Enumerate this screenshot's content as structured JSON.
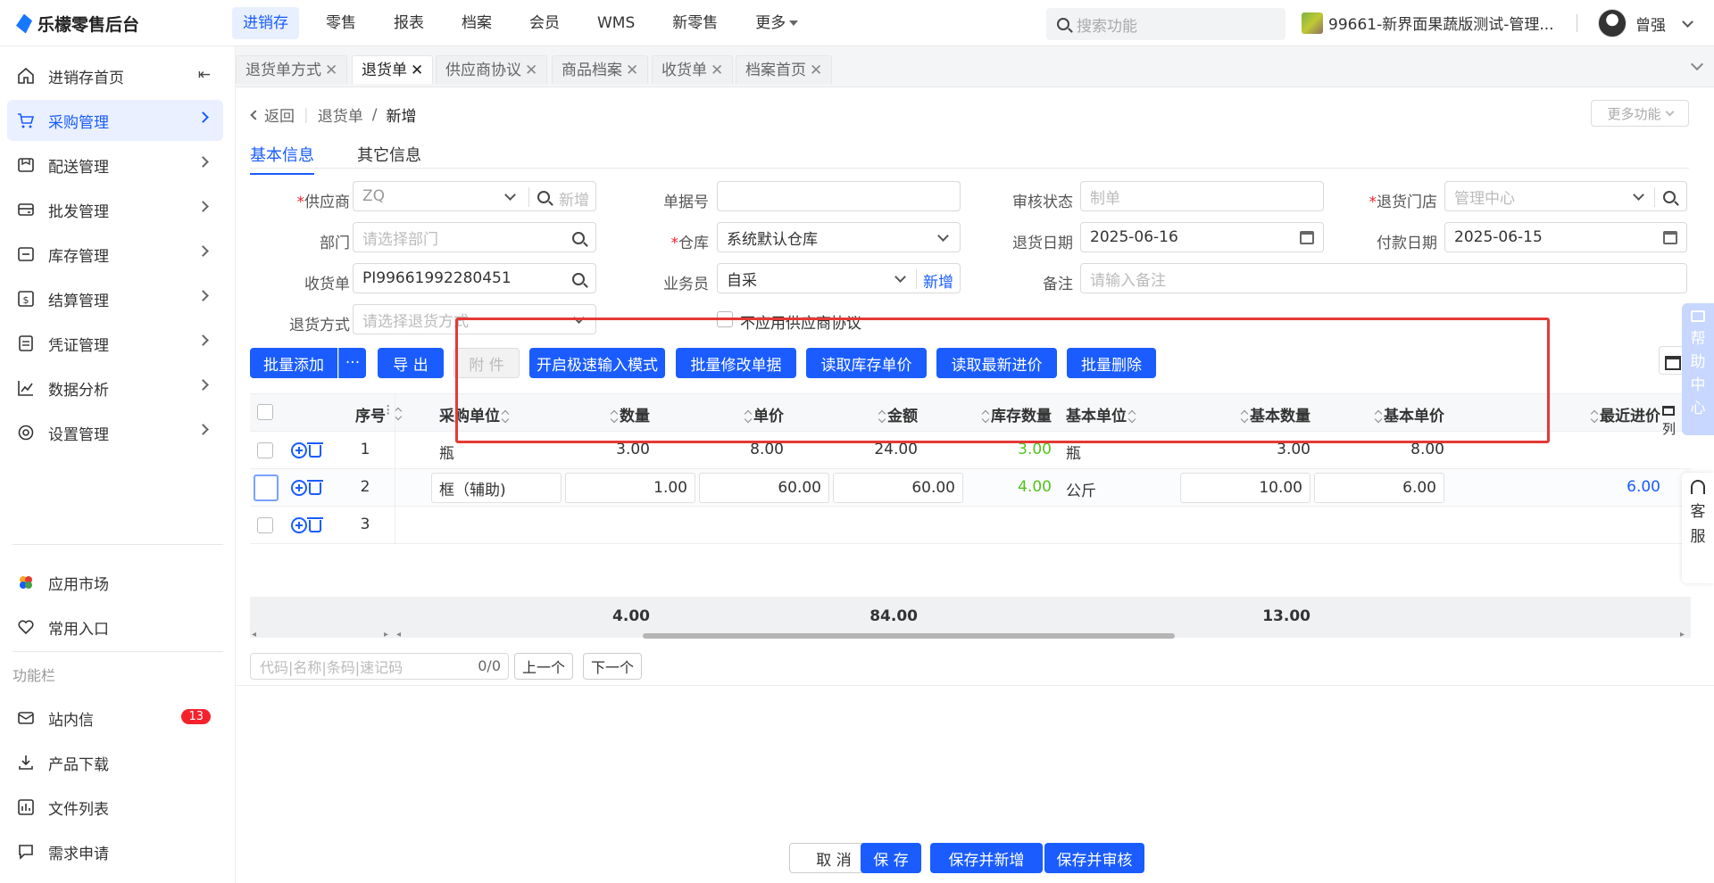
{
  "app": {
    "title": "乐檬零售后台"
  },
  "topnav": {
    "items": [
      "进销存",
      "零售",
      "报表",
      "档案",
      "会员",
      "WMS",
      "新零售",
      "更多"
    ],
    "active": "进销存"
  },
  "search": {
    "placeholder": "搜索功能"
  },
  "store": {
    "name": "99661-新界面果蔬版测试-管理..."
  },
  "user": {
    "name": "曾强"
  },
  "sidebar": {
    "items": [
      {
        "label": "进销存首页",
        "icon": "home-icon"
      },
      {
        "label": "采购管理",
        "icon": "cart-icon"
      },
      {
        "label": "配送管理",
        "icon": "delivery-icon"
      },
      {
        "label": "批发管理",
        "icon": "wholesale-icon"
      },
      {
        "label": "库存管理",
        "icon": "inventory-icon"
      },
      {
        "label": "结算管理",
        "icon": "settlement-icon"
      },
      {
        "label": "凭证管理",
        "icon": "voucher-icon"
      },
      {
        "label": "数据分析",
        "icon": "chart-icon"
      },
      {
        "label": "设置管理",
        "icon": "settings-icon"
      }
    ],
    "active": "采购管理",
    "extra": [
      {
        "label": "应用市场",
        "icon": "app-market-icon"
      },
      {
        "label": "常用入口",
        "icon": "heart-icon"
      }
    ],
    "section_title": "功能栏",
    "tools": [
      {
        "label": "站内信",
        "icon": "mail-icon",
        "badge": "13"
      },
      {
        "label": "产品下载",
        "icon": "download-icon"
      },
      {
        "label": "文件列表",
        "icon": "file-list-icon"
      },
      {
        "label": "需求申请",
        "icon": "request-icon"
      }
    ]
  },
  "tabs": [
    "退货单方式",
    "退货单",
    "供应商协议",
    "商品档案",
    "收货单",
    "档案首页"
  ],
  "active_tab": "退货单",
  "breadcrumb": {
    "back": "返回",
    "parent": "退货单",
    "current": "新增"
  },
  "more_functions": "更多功能",
  "subtabs": [
    "基本信息",
    "其它信息"
  ],
  "form": {
    "supplier": {
      "label": "供应商",
      "value": "ZQ",
      "add": "新增"
    },
    "doc_no": {
      "label": "单据号",
      "value": ""
    },
    "audit_status": {
      "label": "审核状态",
      "placeholder": "制单"
    },
    "return_store": {
      "label": "退货门店",
      "placeholder": "管理中心"
    },
    "department": {
      "label": "部门",
      "placeholder": "请选择部门"
    },
    "warehouse": {
      "label": "仓库",
      "value": "系统默认仓库"
    },
    "return_date": {
      "label": "退货日期",
      "value": "2025-06-16"
    },
    "pay_date": {
      "label": "付款日期",
      "value": "2025-06-15"
    },
    "receipt": {
      "label": "收货单",
      "value": "PI99661992280451"
    },
    "salesman": {
      "label": "业务员",
      "value": "自采",
      "add": "新增"
    },
    "remark": {
      "label": "备注",
      "placeholder": "请输入备注"
    },
    "return_method": {
      "label": "退货方式",
      "placeholder": "请选择退货方式"
    },
    "no_agreement": {
      "label": "不应用供应商协议"
    }
  },
  "toolbar": {
    "batch_add": "批量添加",
    "more": "···",
    "export": "导 出",
    "attach": "附 件",
    "fast_mode": "开启极速输入模式",
    "batch_edit": "批量修改单据",
    "read_stock_price": "读取库存单价",
    "read_latest_price": "读取最新进价",
    "batch_delete": "批量删除"
  },
  "table": {
    "headers": {
      "seq": "序号",
      "unit": "采购单位",
      "qty": "数量",
      "price": "单价",
      "amount": "金额",
      "stock_qty": "库存数量",
      "base_unit": "基本单位",
      "base_qty": "基本数量",
      "base_price": "基本单价",
      "recent_price": "最近进价",
      "col_setting": "列"
    },
    "rows": [
      {
        "seq": "1",
        "unit": "瓶",
        "qty": "3.00",
        "price": "8.00",
        "amount": "24.00",
        "stock_qty": "3.00",
        "base_unit": "瓶",
        "base_qty": "3.00",
        "base_price": "8.00",
        "recent_price": ""
      },
      {
        "seq": "2",
        "unit": "框（辅助)",
        "qty": "1.00",
        "price": "60.00",
        "amount": "60.00",
        "stock_qty": "4.00",
        "base_unit": "公斤",
        "base_qty": "10.00",
        "base_price": "6.00",
        "recent_price": "6.00"
      },
      {
        "seq": "3",
        "unit": "",
        "qty": "",
        "price": "",
        "amount": "",
        "stock_qty": "",
        "base_unit": "",
        "base_qty": "",
        "base_price": "",
        "recent_price": ""
      }
    ],
    "totals": {
      "qty": "4.00",
      "amount": "84.00",
      "base_qty": "13.00"
    }
  },
  "finder": {
    "placeholder": "代码|名称|条码|速记码",
    "count": "0/0",
    "prev": "上一个",
    "next": "下一个"
  },
  "footer": {
    "cancel": "取 消",
    "save": "保 存",
    "save_new": "保存并新增",
    "save_audit": "保存并审核"
  },
  "help": {
    "label": "帮助中心",
    "chars": [
      "帮",
      "助",
      "中",
      "心"
    ]
  },
  "service": {
    "chars": [
      "客",
      "服"
    ]
  },
  "colors": {
    "primary": "#1a5cff",
    "highlight_box": "#e53935",
    "stock_green": "#52c41a"
  }
}
